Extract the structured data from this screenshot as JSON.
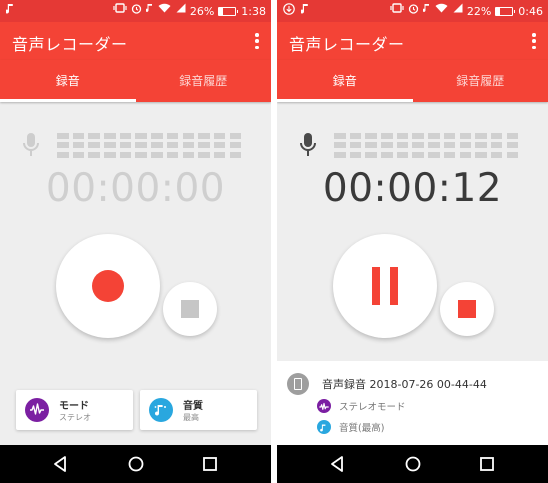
{
  "left_screen": {
    "status": {
      "battery": "26%",
      "time": "1:38",
      "battery_level": 0.26
    },
    "app_title": "音声レコーダー",
    "tabs": [
      {
        "label": "録音",
        "active": true
      },
      {
        "label": "録音履歴",
        "active": false
      }
    ],
    "timer": "00:00:00",
    "cards": {
      "mode": {
        "title": "モード",
        "subtitle": "ステレオ"
      },
      "quality": {
        "title": "音質",
        "subtitle": "最高"
      }
    }
  },
  "right_screen": {
    "status": {
      "battery": "22%",
      "time": "0:46",
      "battery_level": 0.22
    },
    "app_title": "音声レコーダー",
    "tabs": [
      {
        "label": "録音",
        "active": true
      },
      {
        "label": "録音履歴",
        "active": false
      }
    ],
    "timer": "00:00:12",
    "recording": {
      "file_name": "音声録音 2018-07-26 00-44-44",
      "mode": "ステレオモード",
      "quality": "音質(最高)"
    }
  },
  "colors": {
    "status_bar": "#e53935",
    "toolbar": "#f44336",
    "record_red": "#f44336",
    "mode_icon": "#7b1fa2",
    "quality_icon": "#29a7df",
    "background": "#eeeeee"
  },
  "icons": {
    "mic": "microphone-icon",
    "record": "record-dot-icon",
    "pause": "pause-icon",
    "stop": "stop-icon",
    "mode": "waveform-icon",
    "quality": "music-note-icon",
    "file": "phone-file-icon",
    "nav_back": "back-triangle-icon",
    "nav_home": "home-circle-icon",
    "nav_recent": "recent-square-icon"
  }
}
